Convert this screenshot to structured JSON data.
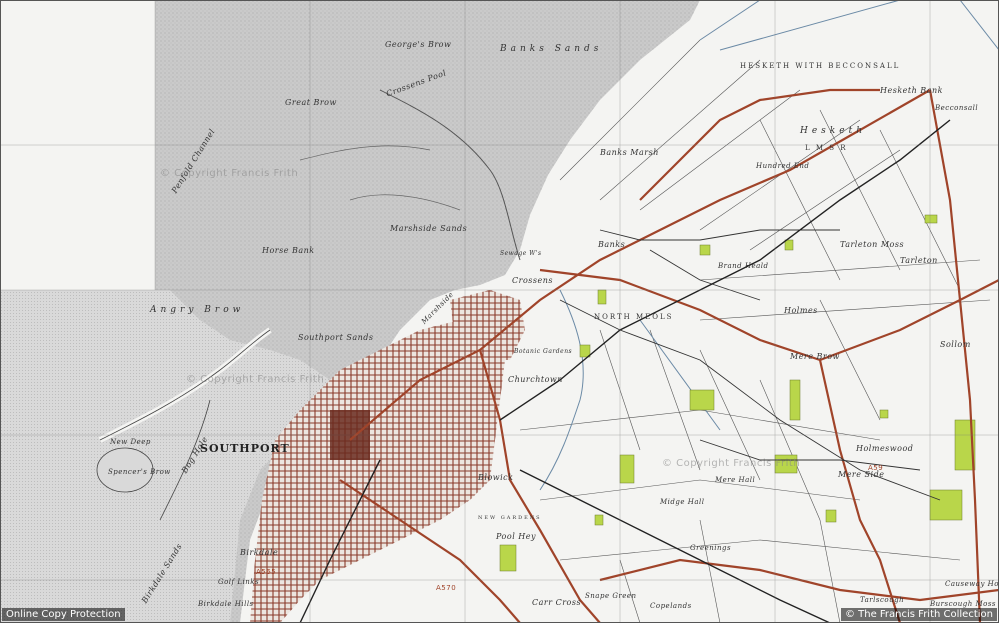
{
  "map": {
    "colors": {
      "sand": "#c8c8c8",
      "land": "#f4f4f2",
      "road": "#a0442a",
      "urban": "#8a3a2a",
      "woodland": "#b9d64a",
      "water": "#dfe6ea",
      "grid": "#777777",
      "rail": "#222222"
    },
    "labels": {
      "georges_brow": "George's Brow",
      "banks_sands": "Banks Sands",
      "great_brow": "Great Brow",
      "crossens_pool": "Crossens Pool",
      "penfold_channel": "Penfold Channel",
      "marshside_sands": "Marshside Sands",
      "horse_bank": "Horse Bank",
      "angry_brow": "Angry Brow",
      "southport_sands": "Southport Sands",
      "southport": "SOUTHPORT",
      "new_deep": "New Deep",
      "spencers_brow": "Spencer's Brow",
      "bog_hole": "Bog Hole",
      "birkdale_sands": "Birkdale Sands",
      "banks_marsh": "Banks Marsh",
      "banks": "Banks",
      "crossens": "Crossens",
      "north_meols": "NORTH MEOLS",
      "churchtown": "Churchtown",
      "blowick": "Blowick",
      "hesketh_bank": "Hesketh Bank",
      "hesketh_with_becconsall": "HESKETH WITH BECCONSALL",
      "becconsall": "Becconsall",
      "hesketh": "Hesketh",
      "lmsr": "L M S R",
      "hundred_end": "Hundred End",
      "tarleton_moss": "Tarleton Moss",
      "tarleton": "Tarleton",
      "holmes": "Holmes",
      "mere_brow": "Mere Brow",
      "sollom": "Sollom",
      "holmeswood": "Holmeswood",
      "mere_side": "Mere Side",
      "pool_hey": "Pool Hey",
      "carr_cross": "Carr Cross",
      "snape_green": "Snape Green",
      "copelands": "Copelands",
      "tarlscough": "Tarlscough",
      "causeway_house": "Causeway House",
      "burscough_moss": "Burscough Moss",
      "birkdale": "Birkdale",
      "birkdale_hills": "Birkdale Hills",
      "golf_links": "Golf Links",
      "marshside": "Marshside",
      "brand_heald": "Brand Heald",
      "sewage_works": "Sewage W's",
      "new_gardens": "NEW GARDENS",
      "greenings": "Greenings",
      "midge_hall": "Midge Hall",
      "mere_hall": "Mere Hall",
      "botanic_gardens": "Botanic Gardens",
      "road_a565": "A565",
      "road_a570": "A570",
      "road_a59": "A59"
    },
    "watermarks": [
      "© Copyright Francis Frith",
      "© Copyright Francis Frith",
      "© Copyright Francis Frith"
    ]
  },
  "copyright": {
    "left": "Online Copy Protection",
    "right": "© The Francis Frith Collection"
  }
}
